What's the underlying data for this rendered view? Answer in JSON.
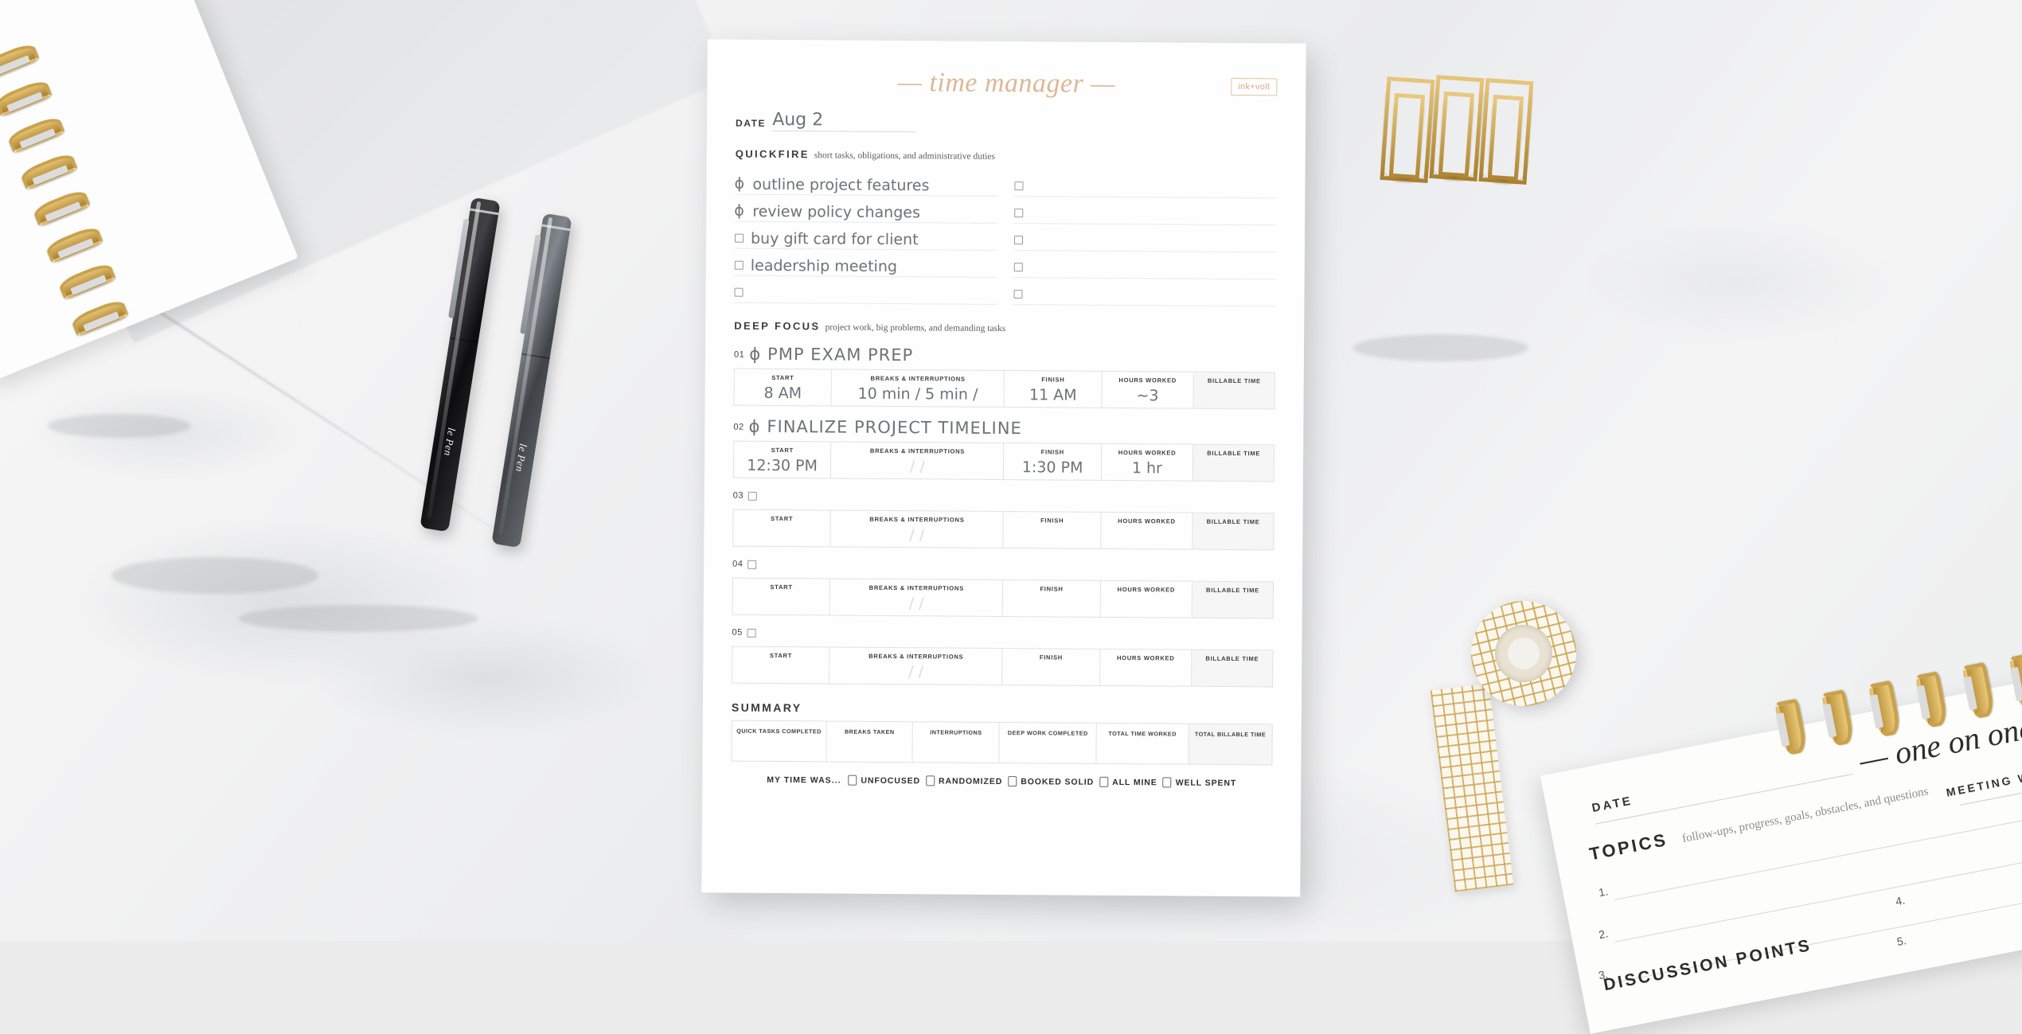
{
  "scene": {
    "surface": "white-marble-desk",
    "props": {
      "notebook_left": "spiral-notebook",
      "notebook_right": "one-on-one-notepad",
      "pens": [
        {
          "name": "le Pen",
          "color": "black"
        },
        {
          "name": "le Pen",
          "color": "gray"
        }
      ],
      "paper_clips": 3,
      "washi_tape": "gold-grid-washi-tape"
    }
  },
  "planner": {
    "brand": "ink+volt",
    "title": "— time manager —",
    "date_label": "DATE",
    "date_value": "Aug 2",
    "quickfire": {
      "heading": "QUICKFIRE",
      "subtitle": "short tasks, obligations, and administrative duties",
      "left_items": [
        {
          "text": "outline project features",
          "checked": true
        },
        {
          "text": "review policy changes",
          "checked": true
        },
        {
          "text": "buy gift card for client",
          "checked": false
        },
        {
          "text": "leadership meeting",
          "checked": false
        },
        {
          "text": "",
          "checked": false
        }
      ],
      "right_items": [
        {
          "text": "",
          "checked": false
        },
        {
          "text": "",
          "checked": false
        },
        {
          "text": "",
          "checked": false
        },
        {
          "text": "",
          "checked": false
        },
        {
          "text": "",
          "checked": false
        }
      ]
    },
    "deep_focus": {
      "heading": "DEEP FOCUS",
      "subtitle": "project work, big problems, and demanding tasks",
      "columns": [
        "START",
        "BREAKS & INTERRUPTIONS",
        "FINISH",
        "HOURS WORKED",
        "BILLABLE TIME"
      ],
      "rows": [
        {
          "num": "01",
          "checked": true,
          "task": "PMP EXAM PREP",
          "start": "8 AM",
          "breaks": "10 min / 5 min /",
          "finish": "11 AM",
          "hours": "~3",
          "billable": ""
        },
        {
          "num": "02",
          "checked": true,
          "task": "FINALIZE PROJECT TIMELINE",
          "start": "12:30 PM",
          "breaks": "/        /",
          "finish": "1:30 PM",
          "hours": "1 hr",
          "billable": ""
        },
        {
          "num": "03",
          "checked": false,
          "task": "",
          "start": "",
          "breaks": "/        /",
          "finish": "",
          "hours": "",
          "billable": ""
        },
        {
          "num": "04",
          "checked": false,
          "task": "",
          "start": "",
          "breaks": "/        /",
          "finish": "",
          "hours": "",
          "billable": ""
        },
        {
          "num": "05",
          "checked": false,
          "task": "",
          "start": "",
          "breaks": "/        /",
          "finish": "",
          "hours": "",
          "billable": ""
        }
      ]
    },
    "summary": {
      "heading": "SUMMARY",
      "columns": [
        "QUICK TASKS COMPLETED",
        "BREAKS TAKEN",
        "INTERRUPTIONS",
        "DEEP WORK COMPLETED",
        "TOTAL TIME WORKED",
        "TOTAL BILLABLE TIME"
      ],
      "values": [
        "",
        "",
        "",
        "",
        "",
        ""
      ]
    },
    "mood": {
      "label": "MY TIME WAS...",
      "options": [
        "UNFOCUSED",
        "RANDOMIZED",
        "BOOKED SOLID",
        "ALL MINE",
        "WELL SPENT"
      ]
    }
  },
  "one_on_one": {
    "title": "— one on one —",
    "date_label": "DATE",
    "topics_label": "TOPICS",
    "topics_subtitle": "follow-ups, progress, goals, obstacles, and questions",
    "meeting_with_label": "MEETING WITH",
    "numbers_left": [
      "1.",
      "2.",
      "3."
    ],
    "numbers_right": [
      "4.",
      "5."
    ],
    "discussion_label": "DISCUSSION POINTS"
  },
  "colors": {
    "accent_tan": "#dcb896",
    "gold": "#c9a24a",
    "ink": "#6f7276",
    "heading": "#3a3a3a",
    "paper": "#fefefe"
  }
}
